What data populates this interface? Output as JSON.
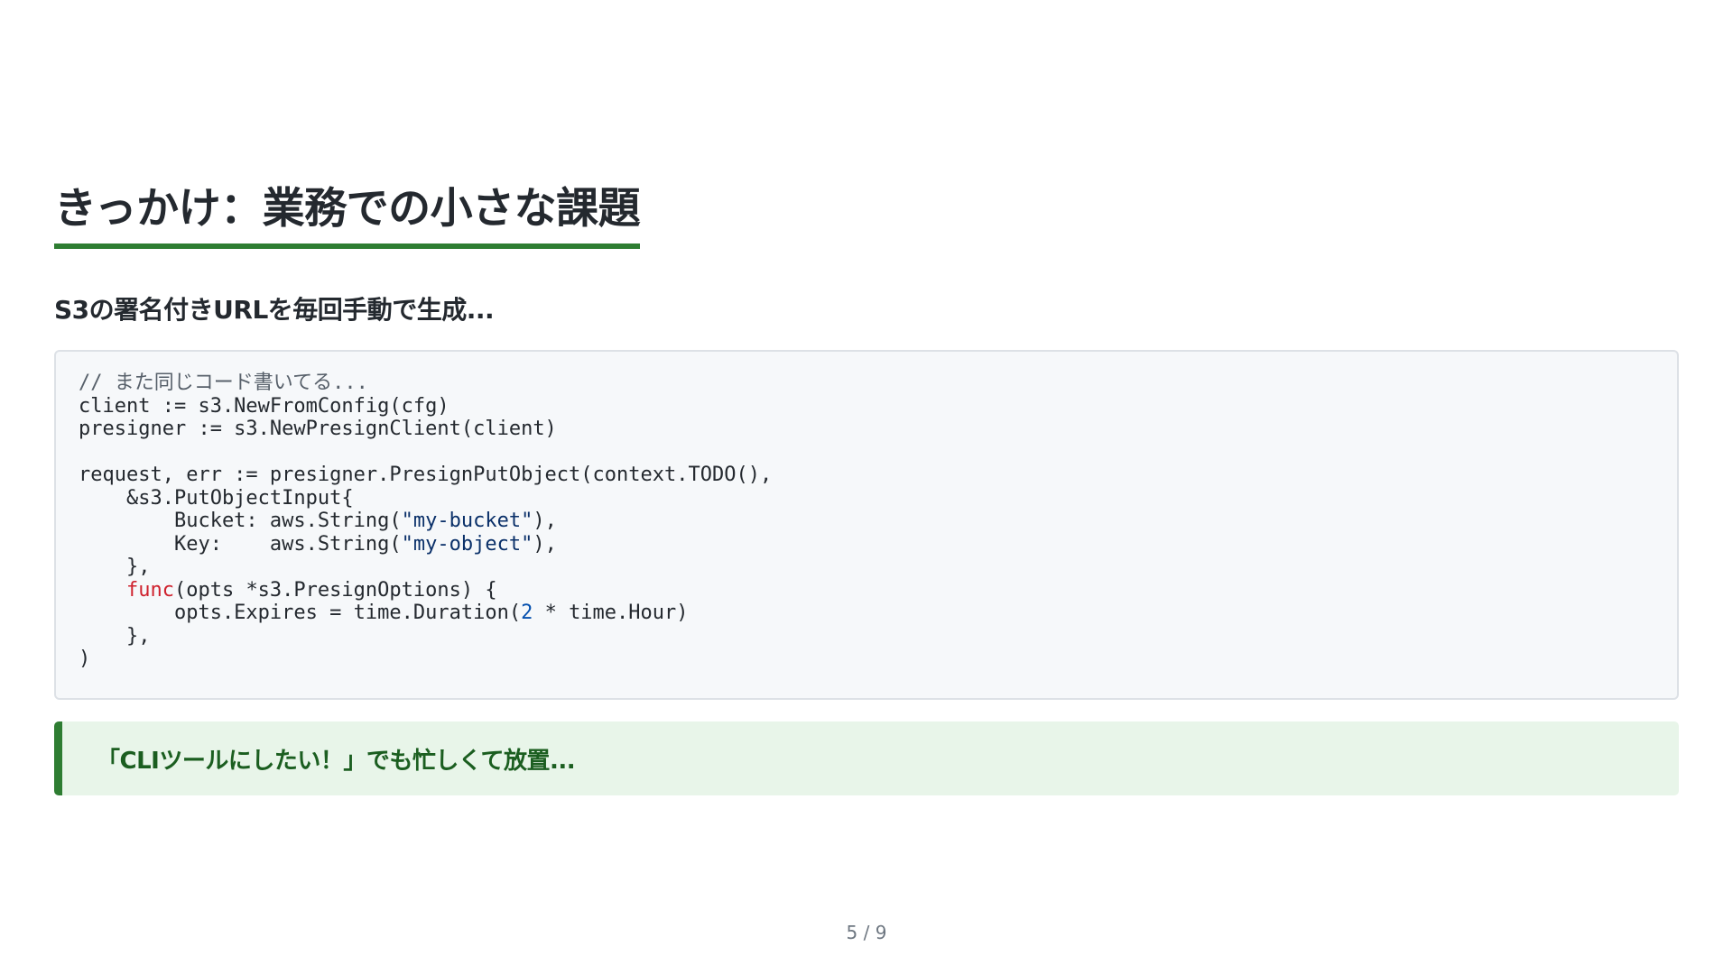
{
  "slide": {
    "title": "きっかけ：業務での小さな課題",
    "subtitle": "S3の署名付きURLを毎回手動で生成...",
    "code": {
      "lines": [
        [
          {
            "t": "// また同じコード書いてる...",
            "k": "comment"
          }
        ],
        [
          {
            "t": "client := s3.NewFromConfig(cfg)",
            "k": "plain"
          }
        ],
        [
          {
            "t": "presigner := s3.NewPresignClient(client)",
            "k": "plain"
          }
        ],
        [],
        [
          {
            "t": "request, err := presigner.PresignPutObject(context.TODO(),",
            "k": "plain"
          }
        ],
        [
          {
            "t": "    &s3.PutObjectInput{",
            "k": "plain"
          }
        ],
        [
          {
            "t": "        Bucket: aws.String(",
            "k": "plain"
          },
          {
            "t": "\"my-bucket\"",
            "k": "string"
          },
          {
            "t": "),",
            "k": "plain"
          }
        ],
        [
          {
            "t": "        Key:    aws.String(",
            "k": "plain"
          },
          {
            "t": "\"my-object\"",
            "k": "string"
          },
          {
            "t": "),",
            "k": "plain"
          }
        ],
        [
          {
            "t": "    },",
            "k": "plain"
          }
        ],
        [
          {
            "t": "    ",
            "k": "plain"
          },
          {
            "t": "func",
            "k": "keyword"
          },
          {
            "t": "(opts *s3.PresignOptions) {",
            "k": "plain"
          }
        ],
        [
          {
            "t": "        opts.Expires = time.Duration(",
            "k": "plain"
          },
          {
            "t": "2",
            "k": "number"
          },
          {
            "t": " * time.Hour)",
            "k": "plain"
          }
        ],
        [
          {
            "t": "    },",
            "k": "plain"
          }
        ],
        [
          {
            "t": ")",
            "k": "plain"
          }
        ]
      ]
    },
    "callout": "「CLIツールにしたい！」でも忙しくて放置...",
    "page_number": "5 / 9",
    "colors": {
      "accent": "#2e7d32",
      "callout_bg": "#e8f5e9",
      "callout_text": "#1b5e20",
      "code_bg": "#f6f8fa",
      "string": "#0a3069",
      "keyword": "#cf222e",
      "number": "#0550ae",
      "comment": "#57606a"
    }
  }
}
